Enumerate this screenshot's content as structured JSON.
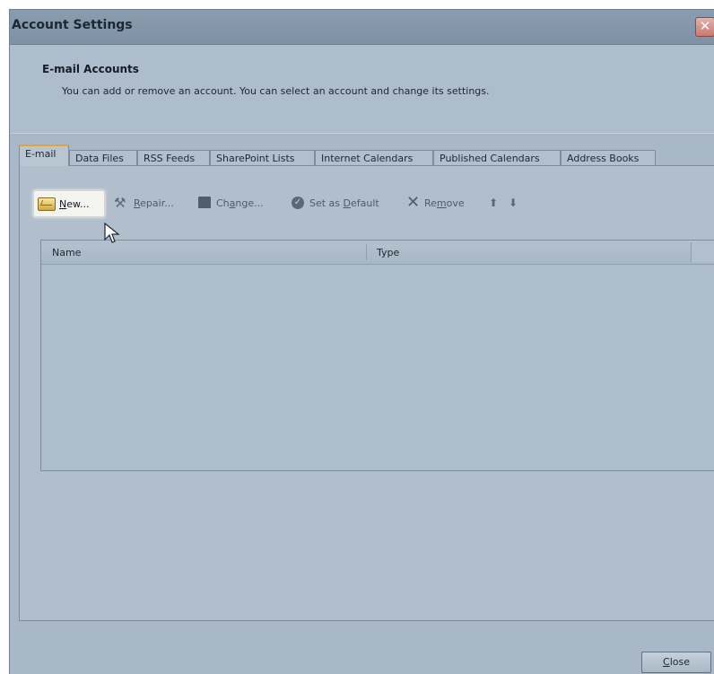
{
  "window": {
    "title": "Account Settings"
  },
  "header": {
    "title": "E-mail Accounts",
    "description": "You can add or remove an account. You can select an account and change its settings."
  },
  "tabs": [
    {
      "label": "E-mail",
      "active": true
    },
    {
      "label": "Data Files"
    },
    {
      "label": "RSS Feeds"
    },
    {
      "label": "SharePoint Lists"
    },
    {
      "label": "Internet Calendars"
    },
    {
      "label": "Published Calendars"
    },
    {
      "label": "Address Books"
    }
  ],
  "toolbar": {
    "new": {
      "pre": "",
      "key": "N",
      "post": "ew..."
    },
    "repair": {
      "pre": "",
      "key": "R",
      "post": "epair..."
    },
    "change": {
      "pre": "Ch",
      "key": "a",
      "post": "nge..."
    },
    "set_default": {
      "pre": "Set as ",
      "key": "D",
      "post": "efault"
    },
    "remove": {
      "pre": "Re",
      "key": "m",
      "post": "ove"
    }
  },
  "list": {
    "columns": [
      "Name",
      "Type"
    ],
    "rows": []
  },
  "footer": {
    "close": {
      "key": "C",
      "post": "lose"
    }
  },
  "icons": {
    "new": "envelope-icon",
    "repair": "tools-icon",
    "change": "folder-edit-icon",
    "set_default": "check-circle-icon",
    "remove": "x-icon",
    "up": "arrow-up-icon",
    "down": "arrow-down-icon",
    "close_window": "close-icon"
  },
  "colors": {
    "window_bg": "#a9b8c6",
    "titlebar": "#8396a9",
    "close_red": "#c77a70",
    "tab_active_accent": "#e3a43e"
  }
}
